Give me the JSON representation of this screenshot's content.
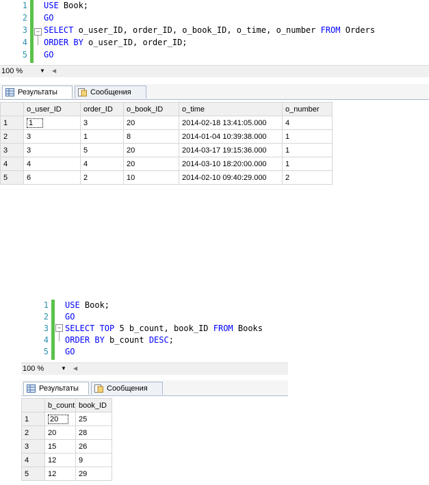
{
  "zoom": "100 %",
  "tabs": {
    "results": "Результаты",
    "messages": "Сообщения"
  },
  "query1": {
    "lines": [
      {
        "n": "1",
        "parts": [
          {
            "k": "kw",
            "t": "USE"
          },
          {
            "k": "code",
            "t": " Book;"
          }
        ]
      },
      {
        "n": "2",
        "parts": [
          {
            "k": "kw",
            "t": "GO"
          }
        ]
      },
      {
        "n": "3",
        "parts": [
          {
            "k": "kw",
            "t": "SELECT"
          },
          {
            "k": "code",
            "t": " o_user_ID, order_ID, o_book_ID, o_time, o_number "
          },
          {
            "k": "kw",
            "t": "FROM"
          },
          {
            "k": "code",
            "t": " Orders"
          }
        ]
      },
      {
        "n": "4",
        "parts": [
          {
            "k": "kw",
            "t": "ORDER BY"
          },
          {
            "k": "code",
            "t": " o_user_ID, order_ID;"
          }
        ]
      },
      {
        "n": "5",
        "parts": [
          {
            "k": "kw",
            "t": "GO"
          }
        ]
      }
    ],
    "columns": [
      "",
      "o_user_ID",
      "order_ID",
      "o_book_ID",
      "o_time",
      "o_number"
    ],
    "rows": [
      [
        "1",
        "1",
        "3",
        "20",
        "2014-02-18 13:41:05.000",
        "4"
      ],
      [
        "2",
        "3",
        "1",
        "8",
        "2014-01-04 10:39:38.000",
        "1"
      ],
      [
        "3",
        "3",
        "5",
        "20",
        "2014-03-17 19:15:36.000",
        "1"
      ],
      [
        "4",
        "4",
        "4",
        "20",
        "2014-03-10 18:20:00.000",
        "1"
      ],
      [
        "5",
        "6",
        "2",
        "10",
        "2014-02-10 09:40:29.000",
        "2"
      ]
    ]
  },
  "query2": {
    "lines": [
      {
        "n": "1",
        "parts": [
          {
            "k": "kw",
            "t": "USE"
          },
          {
            "k": "code",
            "t": " Book;"
          }
        ]
      },
      {
        "n": "2",
        "parts": [
          {
            "k": "kw",
            "t": "GO"
          }
        ]
      },
      {
        "n": "3",
        "parts": [
          {
            "k": "kw",
            "t": "SELECT TOP"
          },
          {
            "k": "code",
            "t": " 5 b_count, book_ID "
          },
          {
            "k": "kw",
            "t": "FROM"
          },
          {
            "k": "code",
            "t": " Books"
          }
        ]
      },
      {
        "n": "4",
        "parts": [
          {
            "k": "kw",
            "t": "ORDER BY"
          },
          {
            "k": "code",
            "t": " b_count "
          },
          {
            "k": "kw",
            "t": "DESC"
          },
          {
            "k": "code",
            "t": ";"
          }
        ]
      },
      {
        "n": "5",
        "parts": [
          {
            "k": "kw",
            "t": "GO"
          }
        ]
      }
    ],
    "columns": [
      "",
      "b_count",
      "book_ID"
    ],
    "rows": [
      [
        "1",
        "20",
        "25"
      ],
      [
        "2",
        "20",
        "28"
      ],
      [
        "3",
        "15",
        "26"
      ],
      [
        "4",
        "12",
        "9"
      ],
      [
        "5",
        "12",
        "29"
      ]
    ]
  }
}
